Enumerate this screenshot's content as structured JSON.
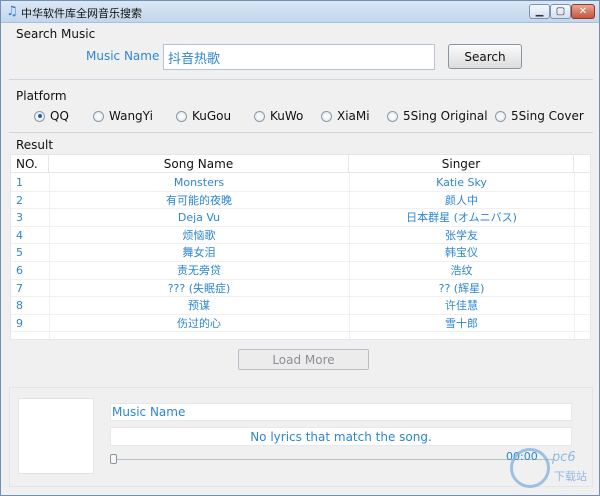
{
  "window": {
    "title": "中华软件库全网音乐搜索",
    "min_label": "▁",
    "max_label": "▢",
    "close_label": "✕"
  },
  "search": {
    "section_label": "Search Music",
    "field_label": "Music Name",
    "value": "抖音热歌",
    "button_label": "Search"
  },
  "platform": {
    "section_label": "Platform",
    "options": [
      "QQ",
      "WangYi",
      "KuGou",
      "KuWo",
      "XiaMi",
      "5Sing Original",
      "5Sing Cover"
    ],
    "selected": "QQ"
  },
  "result": {
    "section_label": "Result",
    "columns": [
      "NO.",
      "Song Name",
      "Singer"
    ],
    "rows": [
      {
        "no": "1",
        "song": "Monsters",
        "singer": "Katie Sky"
      },
      {
        "no": "2",
        "song": "有可能的夜晚",
        "singer": "颜人中"
      },
      {
        "no": "3",
        "song": "Deja Vu",
        "singer": "日本群星 (オムニバス)"
      },
      {
        "no": "4",
        "song": "烦恼歌",
        "singer": "张学友"
      },
      {
        "no": "5",
        "song": "舞女泪",
        "singer": "韩宝仪"
      },
      {
        "no": "6",
        "song": "责无旁贷",
        "singer": "浩纹"
      },
      {
        "no": "7",
        "song": "??? (失眠症)",
        "singer": "?? (辉星)"
      },
      {
        "no": "8",
        "song": "预谋",
        "singer": "许佳慧"
      },
      {
        "no": "9",
        "song": "伤过的心",
        "singer": "雪十郎"
      }
    ],
    "load_more_label": "Load More"
  },
  "player": {
    "music_name": "Music Name",
    "lyrics": "No lyrics that match the song.",
    "time": "00:00",
    "progress": 0
  },
  "watermark": {
    "logo_text": "pc6",
    "site_text": "下载站"
  }
}
